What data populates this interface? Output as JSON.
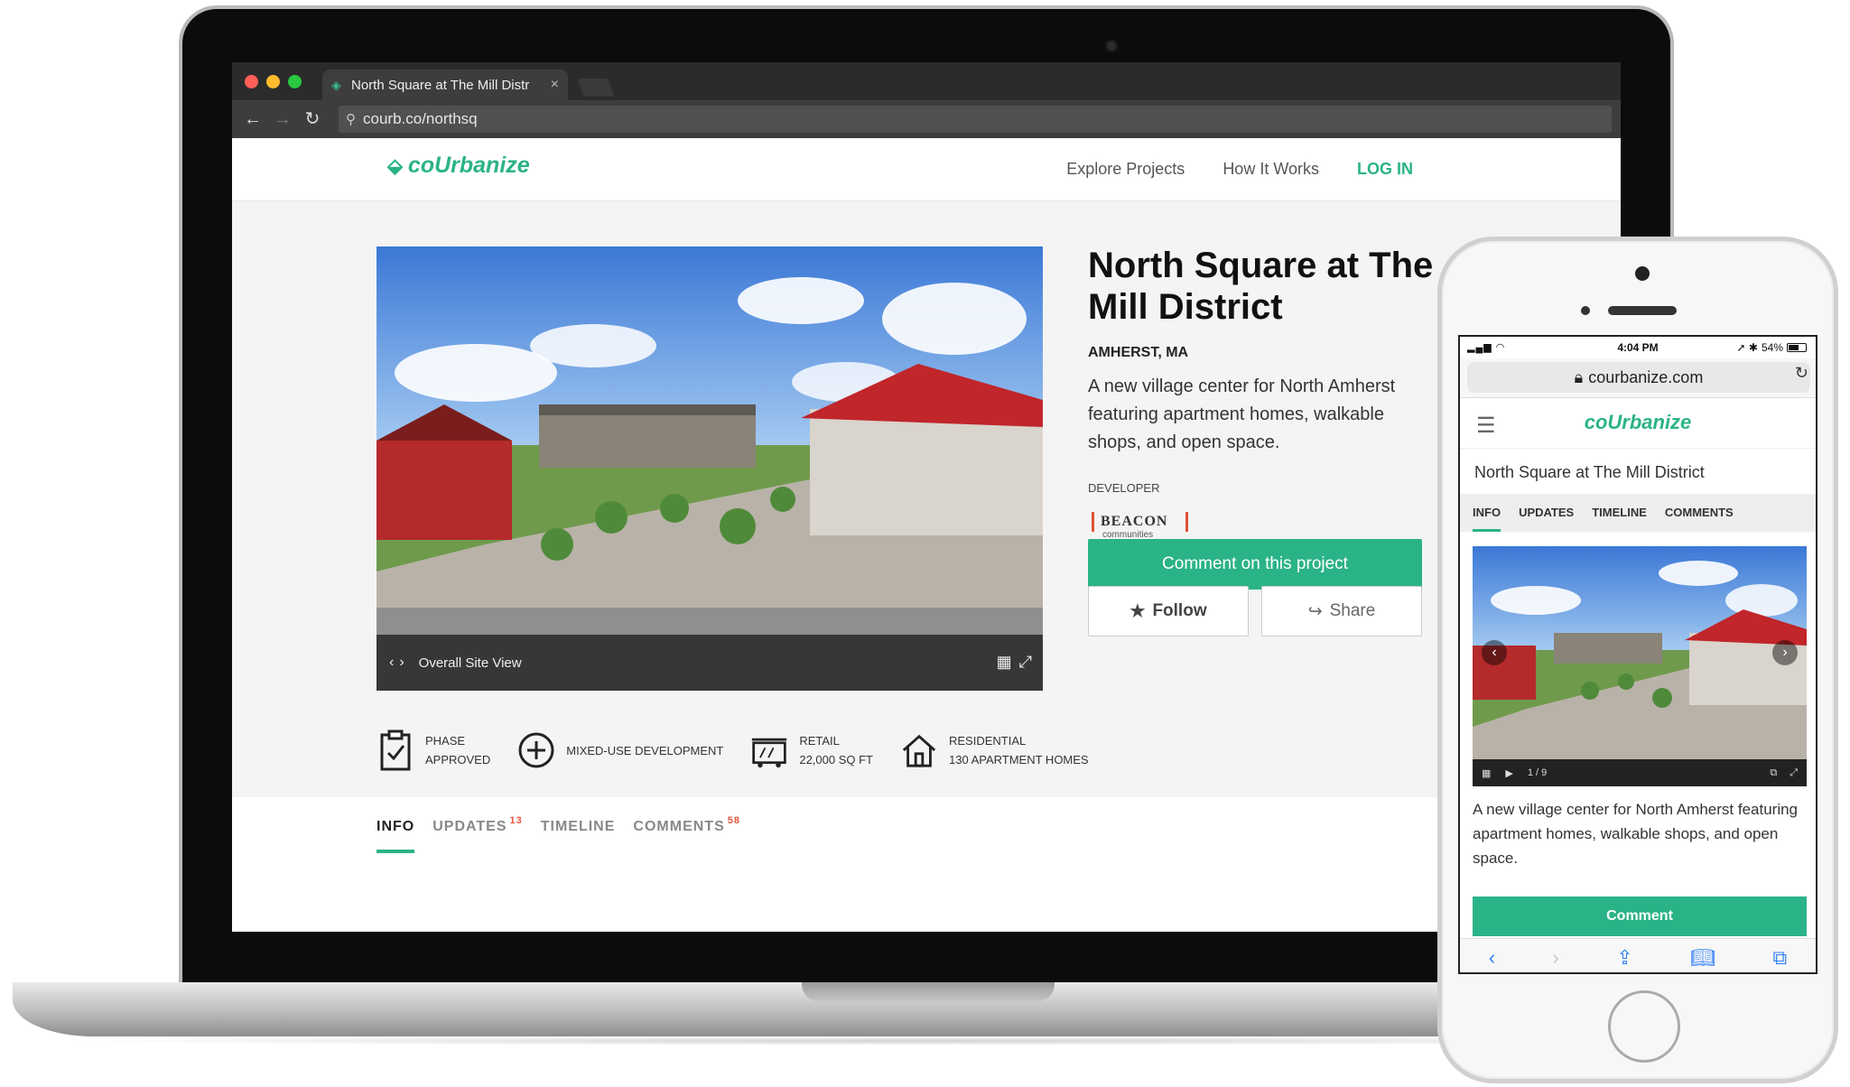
{
  "browser": {
    "tab_title": "North Square at The Mill Distr",
    "tab_close": "×",
    "url": "courb.co/northsq",
    "back": "←",
    "forward": "→",
    "reload": "↻"
  },
  "site": {
    "logo": "coUrbanize",
    "nav": [
      "Explore Projects",
      "How It Works",
      "LOG IN"
    ]
  },
  "hero": {
    "caption": "Overall Site View"
  },
  "project": {
    "title": "North Square at The Mill District",
    "location": "AMHERST, MA",
    "description": "A new village center for North Amherst featuring apartment homes, walkable shops, and open space.",
    "developer_label": "DEVELOPER",
    "developer_logo_name": "BEACON",
    "developer_logo_sub": "communities",
    "comment_button": "Comment on this project",
    "follow_button": "Follow",
    "share_button": "Share"
  },
  "stats": [
    {
      "icon": "clipboard-check-icon",
      "line1": "PHASE",
      "line2": "APPROVED"
    },
    {
      "icon": "plus-circle-icon",
      "line1": "MIXED-USE DEVELOPMENT",
      "line2": ""
    },
    {
      "icon": "storefront-icon",
      "line1": "RETAIL",
      "line2": "22,000 SQ FT"
    },
    {
      "icon": "house-icon",
      "line1": "RESIDENTIAL",
      "line2": "130 APARTMENT HOMES"
    }
  ],
  "page_tabs": [
    {
      "label": "INFO",
      "count": ""
    },
    {
      "label": "UPDATES",
      "count": "13"
    },
    {
      "label": "TIMELINE",
      "count": ""
    },
    {
      "label": "COMMENTS",
      "count": "58"
    }
  ],
  "phone": {
    "status_time": "4:04 PM",
    "status_battery": "54%",
    "url": "courbanize.com",
    "logo": "coUrbanize",
    "title": "North Square at The Mill District",
    "tabs": [
      "INFO",
      "UPDATES",
      "TIMELINE",
      "COMMENTS"
    ],
    "slide_counter": "1 / 9",
    "description": "A new village center for North Amherst featuring apartment homes, walkable shops, and open space.",
    "comment_button": "Comment"
  },
  "colors": {
    "brand_green": "#2bb388",
    "count_red": "#e8553e"
  }
}
